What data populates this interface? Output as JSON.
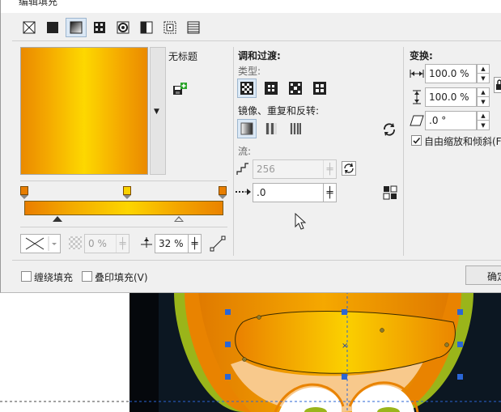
{
  "title": "编辑填充",
  "preset": {
    "name": "无标题"
  },
  "blend": {
    "section_title": "调和过渡:",
    "type_label": "类型:",
    "mirror_label": "镜像、重复和反转:",
    "stream_label": "流:",
    "steps_value": "256",
    "acceleration_value": ".0"
  },
  "transform": {
    "section_title": "变换:",
    "width_value": "100.0 %",
    "height_value": "100.0 %",
    "skew_value": ".0 °",
    "free_scale_label": "自由缩放和倾斜(F)"
  },
  "bottom": {
    "transparency_value": "0 %",
    "midpoint_value": "32 %"
  },
  "footer": {
    "wrap_label": "缠绕填充",
    "overprint_label": "叠印填充(V)",
    "ok_label": "确定"
  },
  "colors": {
    "accent": "#ea8a00",
    "gradient_mid": "#fdd800",
    "selection": "#dbe8f5"
  }
}
